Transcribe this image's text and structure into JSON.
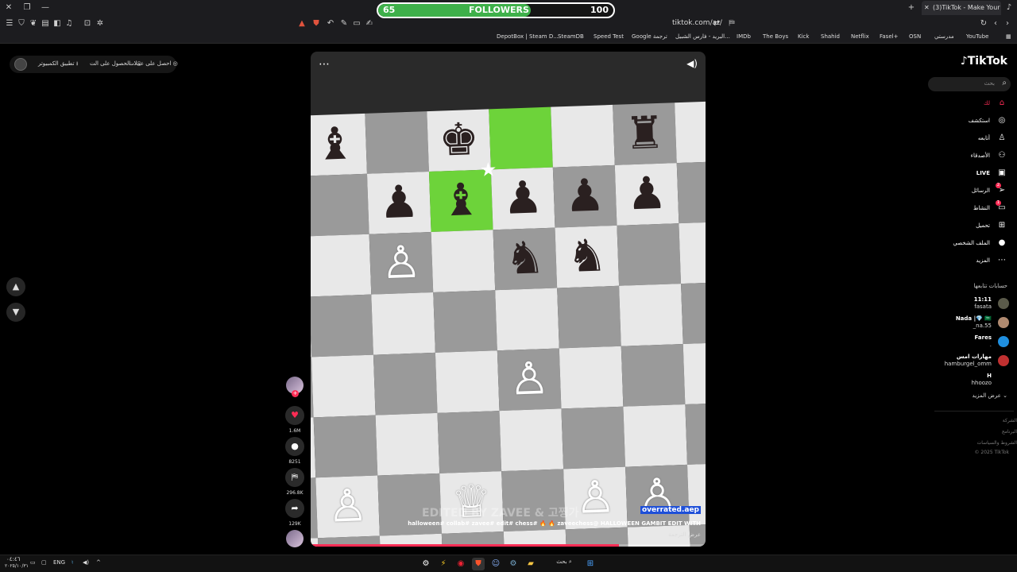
{
  "browser": {
    "followers_widget": {
      "current": "65",
      "label": "FOLLOWERS",
      "goal": "100",
      "progress": 0.65
    },
    "tab_title": "(3)TikTok - Make Your Day",
    "url": "tiktok.com/ar/",
    "bookmarks": [
      "DepotBox | Steam D...",
      "SteamDB",
      "Speed Test",
      "Google ترجمة",
      "البريد - فارس الشبيل...",
      "IMDb",
      "The Boys",
      "Kick",
      "Shahid",
      "Netflix",
      "Fasel+",
      "OSN",
      "مدرستي",
      "YouTube"
    ]
  },
  "topbar": {
    "get_coins": "احصل على عملات",
    "get_app": "الحصول على الت...",
    "pc_app": "تطبيق الكمبيوتر"
  },
  "video": {
    "watermark": "EDITED BY ZAVEE & 고찡가",
    "username": "overrated.aep",
    "caption": "halloween# collab# zavee# edit# chess# 🔥 🔥 zaveechess@ HALLOWEEN GAMBIT EDIT WITH",
    "see_translation": "عرض الترجمة",
    "progress": 0.78,
    "board": {
      "highlight": [
        [
          0,
          3
        ],
        [
          1,
          2
        ]
      ],
      "pieces": [
        {
          "r": 0,
          "c": 0,
          "p": "♝",
          "color": "b"
        },
        {
          "r": 0,
          "c": 2,
          "p": "♚",
          "color": "b"
        },
        {
          "r": 0,
          "c": 5,
          "p": "♜",
          "color": "b"
        },
        {
          "r": 1,
          "c": -1,
          "p": "♞",
          "color": "b"
        },
        {
          "r": 1,
          "c": 1,
          "p": "♟",
          "color": "b"
        },
        {
          "r": 1,
          "c": 2,
          "p": "♝",
          "color": "b"
        },
        {
          "r": 1,
          "c": 3,
          "p": "♟",
          "color": "b"
        },
        {
          "r": 1,
          "c": 4,
          "p": "♟",
          "color": "b"
        },
        {
          "r": 1,
          "c": 5,
          "p": "♟",
          "color": "b"
        },
        {
          "r": 2,
          "c": -1,
          "p": "♙",
          "color": "w"
        },
        {
          "r": 2,
          "c": 1,
          "p": "♙",
          "color": "w"
        },
        {
          "r": 2,
          "c": 3,
          "p": "♞",
          "color": "b"
        },
        {
          "r": 2,
          "c": 4,
          "p": "♞",
          "color": "b"
        },
        {
          "r": 4,
          "c": 3,
          "p": "♙",
          "color": "w"
        },
        {
          "r": 6,
          "c": -1,
          "p": "♙",
          "color": "w"
        },
        {
          "r": 6,
          "c": 0,
          "p": "♙",
          "color": "w"
        },
        {
          "r": 6,
          "c": 2,
          "p": "♕",
          "color": "w"
        },
        {
          "r": 6,
          "c": 4,
          "p": "♙",
          "color": "w"
        },
        {
          "r": 6,
          "c": 5,
          "p": "♙",
          "color": "w"
        }
      ]
    }
  },
  "actions": {
    "likes": "1.6M",
    "comments": "8251",
    "saves": "296.8K",
    "shares": "129K"
  },
  "sidebar": {
    "logo": "TikTok",
    "search_placeholder": "بحث",
    "nav": [
      {
        "label": "لك",
        "icon": "home-icon",
        "glyph": "⌂",
        "badge": ""
      },
      {
        "label": "استكشف",
        "icon": "compass-icon",
        "glyph": "◎",
        "badge": ""
      },
      {
        "label": "أتابعه",
        "icon": "person-add-icon",
        "glyph": "♙",
        "badge": ""
      },
      {
        "label": "الأصدقاء",
        "icon": "friends-icon",
        "glyph": "⚇",
        "badge": ""
      },
      {
        "label": "LIVE",
        "icon": "live-icon",
        "glyph": "▣",
        "badge": ""
      },
      {
        "label": "الرسائل",
        "icon": "messages-icon",
        "glyph": "➢",
        "badge": "2"
      },
      {
        "label": "النشاط",
        "icon": "activity-icon",
        "glyph": "▭",
        "badge": "1"
      },
      {
        "label": "تحميل",
        "icon": "upload-icon",
        "glyph": "⊞",
        "badge": ""
      },
      {
        "label": "الملف الشخصي",
        "icon": "profile-avatar-icon",
        "glyph": "●",
        "badge": ""
      },
      {
        "label": "المزيد",
        "icon": "more-icon",
        "glyph": "⋯",
        "badge": ""
      }
    ],
    "following_title": "حسابات تتابعها",
    "following": [
      {
        "name": "11:11",
        "handle": "fasata",
        "color": "#5a5a4a"
      },
      {
        "name": "Nada |💎 🇸🇦",
        "handle": "_na.55",
        "color": "#b08a70"
      },
      {
        "name": "Fares",
        "handle": ".",
        "color": "#1f8fe0"
      },
      {
        "name": "مهارات امس",
        "handle": "hamburgel_omm",
        "color": "#c03030"
      },
      {
        "name": "H",
        "handle": "hhoozo",
        "color": "#000000"
      }
    ],
    "see_more": "عرض المزيد",
    "footer": [
      "الشركة",
      "البرنامج",
      "الشروط والسياسات",
      "© 2025 TikTok"
    ]
  },
  "taskbar": {
    "time": "٠٤:٤٦",
    "date": "٢٠٢٥/١٠/٣١",
    "lang": "ENG",
    "search": "بحث"
  }
}
